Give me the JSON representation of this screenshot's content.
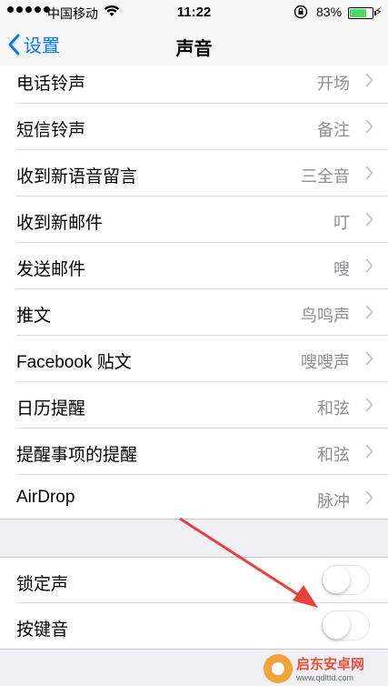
{
  "status_bar": {
    "carrier": "中国移动",
    "time": "11:22",
    "battery_percent": "83%",
    "battery_level": 0.83
  },
  "nav": {
    "back_label": "设置",
    "title": "声音"
  },
  "sound_rows": [
    {
      "label": "电话铃声",
      "value": "开场"
    },
    {
      "label": "短信铃声",
      "value": "备注"
    },
    {
      "label": "收到新语音留言",
      "value": "三全音"
    },
    {
      "label": "收到新邮件",
      "value": "叮"
    },
    {
      "label": "发送邮件",
      "value": "嗖"
    },
    {
      "label": "推文",
      "value": "鸟鸣声"
    },
    {
      "label": "Facebook 贴文",
      "value": "嗖嗖声"
    },
    {
      "label": "日历提醒",
      "value": "和弦"
    },
    {
      "label": "提醒事项的提醒",
      "value": "和弦"
    },
    {
      "label": "AirDrop",
      "value": "脉冲"
    }
  ],
  "toggle_rows": [
    {
      "label": "锁定声",
      "on": false
    },
    {
      "label": "按键音",
      "on": false
    }
  ],
  "watermark": {
    "name": "启东安卓网",
    "url": "www.qdlttd.com"
  },
  "colors": {
    "accent": "#007aff",
    "annotation_arrow": "#e8403a",
    "battery_fill": "#4cd964"
  }
}
